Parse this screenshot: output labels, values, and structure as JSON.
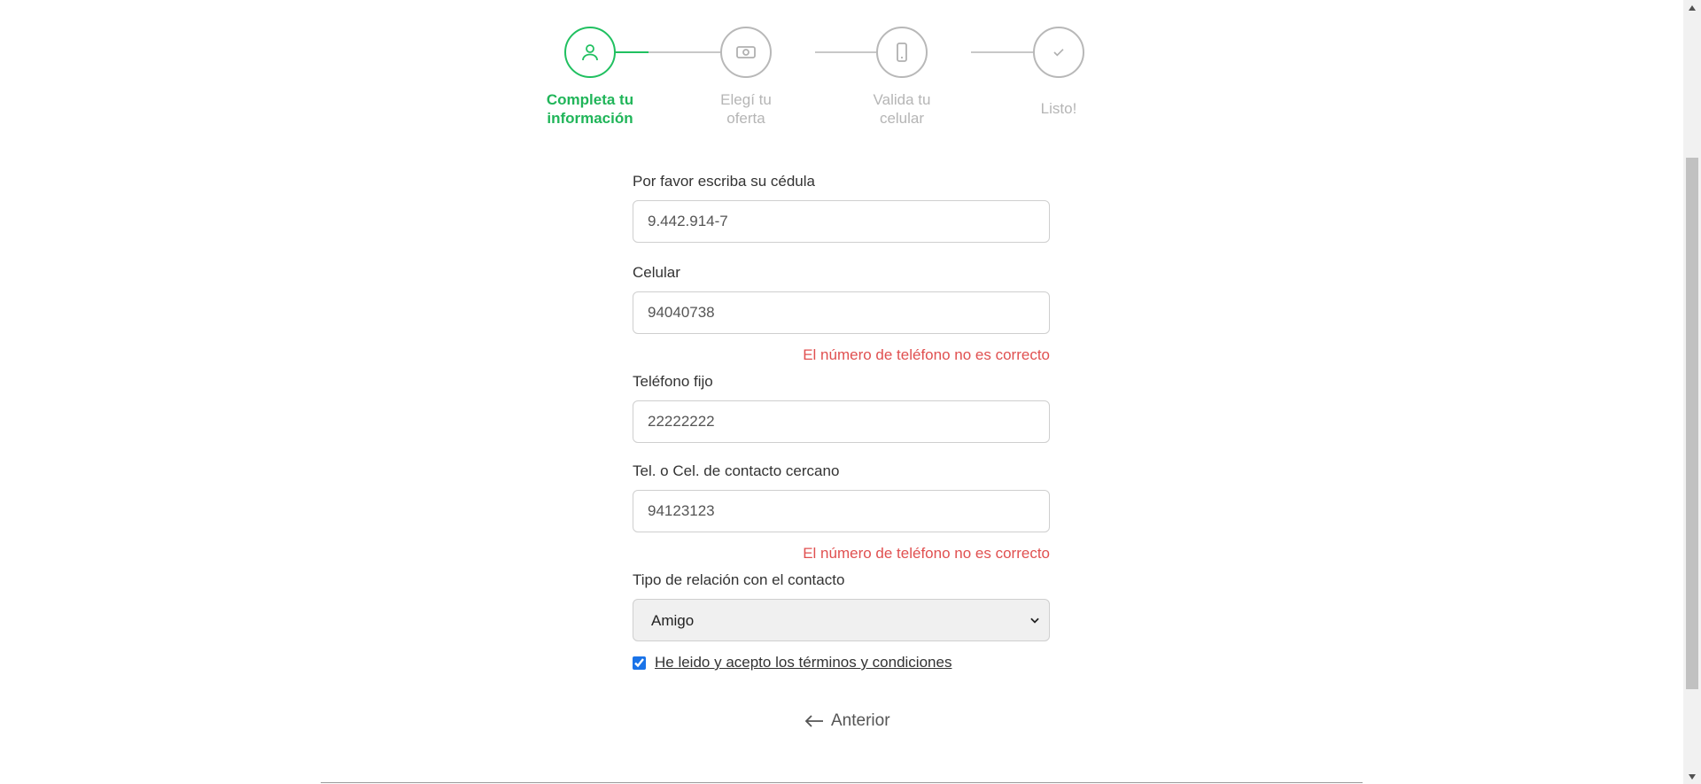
{
  "stepper": {
    "steps": [
      {
        "line1": "Completa tu",
        "line2": "información",
        "icon": "user-icon",
        "state": "active"
      },
      {
        "line1": "Elegí tu",
        "line2": "oferta",
        "icon": "money-icon",
        "state": "pending"
      },
      {
        "line1": "Valida tu",
        "line2": "celular",
        "icon": "phone-icon",
        "state": "pending"
      },
      {
        "line1": "Listo!",
        "icon": "check-icon",
        "state": "pending"
      }
    ],
    "active_color": "#20c060",
    "inactive_color": "#b8b8b8"
  },
  "form": {
    "cedula": {
      "label": "Por favor escriba su cédula",
      "value": "9.442.914-7"
    },
    "celular": {
      "label": "Celular",
      "value": "94040738",
      "error": "El número de teléfono no es correcto"
    },
    "telefono_fijo": {
      "label": "Teléfono fijo",
      "value": "22222222"
    },
    "contacto": {
      "label": "Tel. o Cel. de contacto cercano",
      "value": "94123123",
      "error": "El número de teléfono no es correcto"
    },
    "relacion": {
      "label": "Tipo de relación con el contacto",
      "selected": "Amigo"
    },
    "terms": {
      "label": "He leido y acepto los términos y condiciones",
      "checked": true
    }
  },
  "nav": {
    "back_label": "Anterior"
  },
  "colors": {
    "error": "#e05050",
    "accent": "#20c060"
  }
}
